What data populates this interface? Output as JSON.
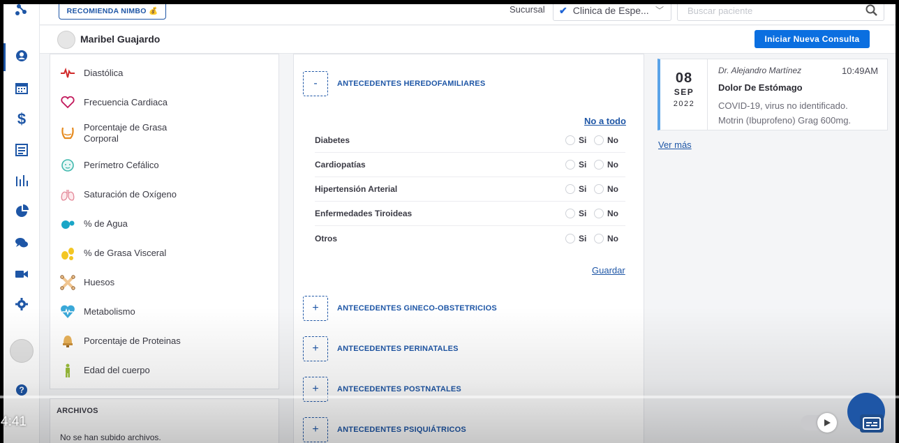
{
  "topbar": {
    "recommend_label": "RECOMIENDA NIMBO 💰",
    "sucursal_label": "Sucursal",
    "sucursal_value": "Clinica de Espe...",
    "search_placeholder": "Buscar paciente"
  },
  "patient": {
    "name": "Maribel Guajardo",
    "new_consult_label": "Iniciar Nueva Consulta"
  },
  "vitals": [
    {
      "label": "Diastólica",
      "icon": "heartbeat-icon"
    },
    {
      "label": "Frecuencia Cardiaca",
      "icon": "heart-icon"
    },
    {
      "label": "Porcentaje de Grasa\nCorporal",
      "icon": "body-fat-icon"
    },
    {
      "label": "Perímetro Cefálico",
      "icon": "baby-head-icon"
    },
    {
      "label": "Saturación de Oxígeno",
      "icon": "lungs-icon"
    },
    {
      "label": "% de Agua",
      "icon": "water-drops-icon"
    },
    {
      "label": "% de Grasa Visceral",
      "icon": "visceral-fat-icon"
    },
    {
      "label": "Huesos",
      "icon": "bones-icon"
    },
    {
      "label": "Metabolismo",
      "icon": "metabolism-heart-icon"
    },
    {
      "label": "Porcentaje de Proteinas",
      "icon": "protein-icon"
    },
    {
      "label": "Edad del cuerpo",
      "icon": "body-age-icon"
    }
  ],
  "files": {
    "title": "ARCHIVOS",
    "empty_text": "No se han subido archivos."
  },
  "antecedents": {
    "expanded": {
      "toggle": "-",
      "title": "ANTECEDENTES HEREDOFAMILIARES",
      "none_all_label": "No a todo",
      "conditions": [
        {
          "name": "Diabetes"
        },
        {
          "name": "Cardiopatías"
        },
        {
          "name": "Hipertensión Arterial"
        },
        {
          "name": "Enfermedades Tiroideas"
        },
        {
          "name": "Otros"
        }
      ],
      "yes_label": "Si",
      "no_label": "No",
      "save_label": "Guardar"
    },
    "collapsed": [
      {
        "toggle": "+",
        "title": "ANTECEDENTES GINECO-OBSTETRICIOS"
      },
      {
        "toggle": "+",
        "title": "ANTECEDENTES PERINATALES"
      },
      {
        "toggle": "+",
        "title": "ANTECEDENTES POSTNATALES"
      },
      {
        "toggle": "+",
        "title": "ANTECEDENTES PSIQUIÁTRICOS"
      }
    ]
  },
  "consultation": {
    "day": "08",
    "month": "SEP",
    "year": "2022",
    "doctor": "Dr. Alejandro Martínez",
    "time": "10:49AM",
    "reason": "Dolor De Estómago",
    "diagnosis": "COVID-19, virus no identificado.",
    "prescription": "Motrin (Ibuprofeno) Grag 600mg.",
    "see_more_label": "Ver más"
  },
  "video": {
    "time": "4:41"
  },
  "colors": {
    "brand_blue": "#1e56a6",
    "button_blue": "#0b6fe0",
    "card_accent": "#5aa3e8"
  }
}
